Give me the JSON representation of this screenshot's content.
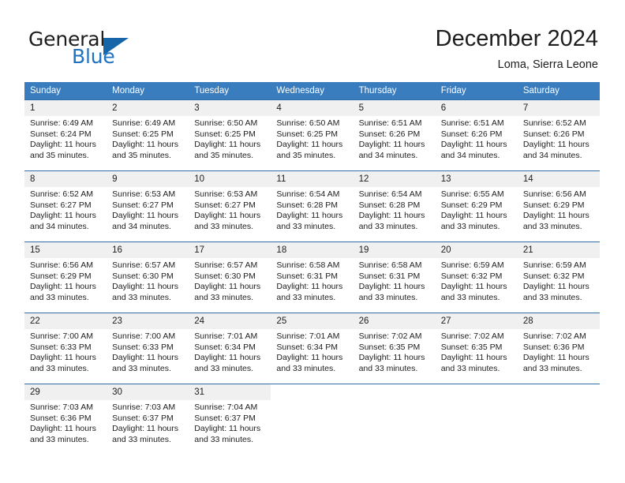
{
  "brand": {
    "name_part1": "General",
    "name_part2": "Blue",
    "logo_icon": "blue-triangle-flag-icon",
    "accent_color": "#1f72c2"
  },
  "header": {
    "month_title": "December 2024",
    "location": "Loma, Sierra Leone"
  },
  "calendar": {
    "header_bg_color": "#3a7dbf",
    "daynum_bg_color": "#f0f0f0",
    "weekdays": [
      "Sunday",
      "Monday",
      "Tuesday",
      "Wednesday",
      "Thursday",
      "Friday",
      "Saturday"
    ],
    "weeks": [
      [
        {
          "day": "1",
          "sunrise": "Sunrise: 6:49 AM",
          "sunset": "Sunset: 6:24 PM",
          "daylight_line1": "Daylight: 11 hours",
          "daylight_line2": "and 35 minutes."
        },
        {
          "day": "2",
          "sunrise": "Sunrise: 6:49 AM",
          "sunset": "Sunset: 6:25 PM",
          "daylight_line1": "Daylight: 11 hours",
          "daylight_line2": "and 35 minutes."
        },
        {
          "day": "3",
          "sunrise": "Sunrise: 6:50 AM",
          "sunset": "Sunset: 6:25 PM",
          "daylight_line1": "Daylight: 11 hours",
          "daylight_line2": "and 35 minutes."
        },
        {
          "day": "4",
          "sunrise": "Sunrise: 6:50 AM",
          "sunset": "Sunset: 6:25 PM",
          "daylight_line1": "Daylight: 11 hours",
          "daylight_line2": "and 35 minutes."
        },
        {
          "day": "5",
          "sunrise": "Sunrise: 6:51 AM",
          "sunset": "Sunset: 6:26 PM",
          "daylight_line1": "Daylight: 11 hours",
          "daylight_line2": "and 34 minutes."
        },
        {
          "day": "6",
          "sunrise": "Sunrise: 6:51 AM",
          "sunset": "Sunset: 6:26 PM",
          "daylight_line1": "Daylight: 11 hours",
          "daylight_line2": "and 34 minutes."
        },
        {
          "day": "7",
          "sunrise": "Sunrise: 6:52 AM",
          "sunset": "Sunset: 6:26 PM",
          "daylight_line1": "Daylight: 11 hours",
          "daylight_line2": "and 34 minutes."
        }
      ],
      [
        {
          "day": "8",
          "sunrise": "Sunrise: 6:52 AM",
          "sunset": "Sunset: 6:27 PM",
          "daylight_line1": "Daylight: 11 hours",
          "daylight_line2": "and 34 minutes."
        },
        {
          "day": "9",
          "sunrise": "Sunrise: 6:53 AM",
          "sunset": "Sunset: 6:27 PM",
          "daylight_line1": "Daylight: 11 hours",
          "daylight_line2": "and 34 minutes."
        },
        {
          "day": "10",
          "sunrise": "Sunrise: 6:53 AM",
          "sunset": "Sunset: 6:27 PM",
          "daylight_line1": "Daylight: 11 hours",
          "daylight_line2": "and 33 minutes."
        },
        {
          "day": "11",
          "sunrise": "Sunrise: 6:54 AM",
          "sunset": "Sunset: 6:28 PM",
          "daylight_line1": "Daylight: 11 hours",
          "daylight_line2": "and 33 minutes."
        },
        {
          "day": "12",
          "sunrise": "Sunrise: 6:54 AM",
          "sunset": "Sunset: 6:28 PM",
          "daylight_line1": "Daylight: 11 hours",
          "daylight_line2": "and 33 minutes."
        },
        {
          "day": "13",
          "sunrise": "Sunrise: 6:55 AM",
          "sunset": "Sunset: 6:29 PM",
          "daylight_line1": "Daylight: 11 hours",
          "daylight_line2": "and 33 minutes."
        },
        {
          "day": "14",
          "sunrise": "Sunrise: 6:56 AM",
          "sunset": "Sunset: 6:29 PM",
          "daylight_line1": "Daylight: 11 hours",
          "daylight_line2": "and 33 minutes."
        }
      ],
      [
        {
          "day": "15",
          "sunrise": "Sunrise: 6:56 AM",
          "sunset": "Sunset: 6:29 PM",
          "daylight_line1": "Daylight: 11 hours",
          "daylight_line2": "and 33 minutes."
        },
        {
          "day": "16",
          "sunrise": "Sunrise: 6:57 AM",
          "sunset": "Sunset: 6:30 PM",
          "daylight_line1": "Daylight: 11 hours",
          "daylight_line2": "and 33 minutes."
        },
        {
          "day": "17",
          "sunrise": "Sunrise: 6:57 AM",
          "sunset": "Sunset: 6:30 PM",
          "daylight_line1": "Daylight: 11 hours",
          "daylight_line2": "and 33 minutes."
        },
        {
          "day": "18",
          "sunrise": "Sunrise: 6:58 AM",
          "sunset": "Sunset: 6:31 PM",
          "daylight_line1": "Daylight: 11 hours",
          "daylight_line2": "and 33 minutes."
        },
        {
          "day": "19",
          "sunrise": "Sunrise: 6:58 AM",
          "sunset": "Sunset: 6:31 PM",
          "daylight_line1": "Daylight: 11 hours",
          "daylight_line2": "and 33 minutes."
        },
        {
          "day": "20",
          "sunrise": "Sunrise: 6:59 AM",
          "sunset": "Sunset: 6:32 PM",
          "daylight_line1": "Daylight: 11 hours",
          "daylight_line2": "and 33 minutes."
        },
        {
          "day": "21",
          "sunrise": "Sunrise: 6:59 AM",
          "sunset": "Sunset: 6:32 PM",
          "daylight_line1": "Daylight: 11 hours",
          "daylight_line2": "and 33 minutes."
        }
      ],
      [
        {
          "day": "22",
          "sunrise": "Sunrise: 7:00 AM",
          "sunset": "Sunset: 6:33 PM",
          "daylight_line1": "Daylight: 11 hours",
          "daylight_line2": "and 33 minutes."
        },
        {
          "day": "23",
          "sunrise": "Sunrise: 7:00 AM",
          "sunset": "Sunset: 6:33 PM",
          "daylight_line1": "Daylight: 11 hours",
          "daylight_line2": "and 33 minutes."
        },
        {
          "day": "24",
          "sunrise": "Sunrise: 7:01 AM",
          "sunset": "Sunset: 6:34 PM",
          "daylight_line1": "Daylight: 11 hours",
          "daylight_line2": "and 33 minutes."
        },
        {
          "day": "25",
          "sunrise": "Sunrise: 7:01 AM",
          "sunset": "Sunset: 6:34 PM",
          "daylight_line1": "Daylight: 11 hours",
          "daylight_line2": "and 33 minutes."
        },
        {
          "day": "26",
          "sunrise": "Sunrise: 7:02 AM",
          "sunset": "Sunset: 6:35 PM",
          "daylight_line1": "Daylight: 11 hours",
          "daylight_line2": "and 33 minutes."
        },
        {
          "day": "27",
          "sunrise": "Sunrise: 7:02 AM",
          "sunset": "Sunset: 6:35 PM",
          "daylight_line1": "Daylight: 11 hours",
          "daylight_line2": "and 33 minutes."
        },
        {
          "day": "28",
          "sunrise": "Sunrise: 7:02 AM",
          "sunset": "Sunset: 6:36 PM",
          "daylight_line1": "Daylight: 11 hours",
          "daylight_line2": "and 33 minutes."
        }
      ],
      [
        {
          "day": "29",
          "sunrise": "Sunrise: 7:03 AM",
          "sunset": "Sunset: 6:36 PM",
          "daylight_line1": "Daylight: 11 hours",
          "daylight_line2": "and 33 minutes."
        },
        {
          "day": "30",
          "sunrise": "Sunrise: 7:03 AM",
          "sunset": "Sunset: 6:37 PM",
          "daylight_line1": "Daylight: 11 hours",
          "daylight_line2": "and 33 minutes."
        },
        {
          "day": "31",
          "sunrise": "Sunrise: 7:04 AM",
          "sunset": "Sunset: 6:37 PM",
          "daylight_line1": "Daylight: 11 hours",
          "daylight_line2": "and 33 minutes."
        },
        {
          "day": "",
          "sunrise": "",
          "sunset": "",
          "daylight_line1": "",
          "daylight_line2": ""
        },
        {
          "day": "",
          "sunrise": "",
          "sunset": "",
          "daylight_line1": "",
          "daylight_line2": ""
        },
        {
          "day": "",
          "sunrise": "",
          "sunset": "",
          "daylight_line1": "",
          "daylight_line2": ""
        },
        {
          "day": "",
          "sunrise": "",
          "sunset": "",
          "daylight_line1": "",
          "daylight_line2": ""
        }
      ]
    ]
  }
}
